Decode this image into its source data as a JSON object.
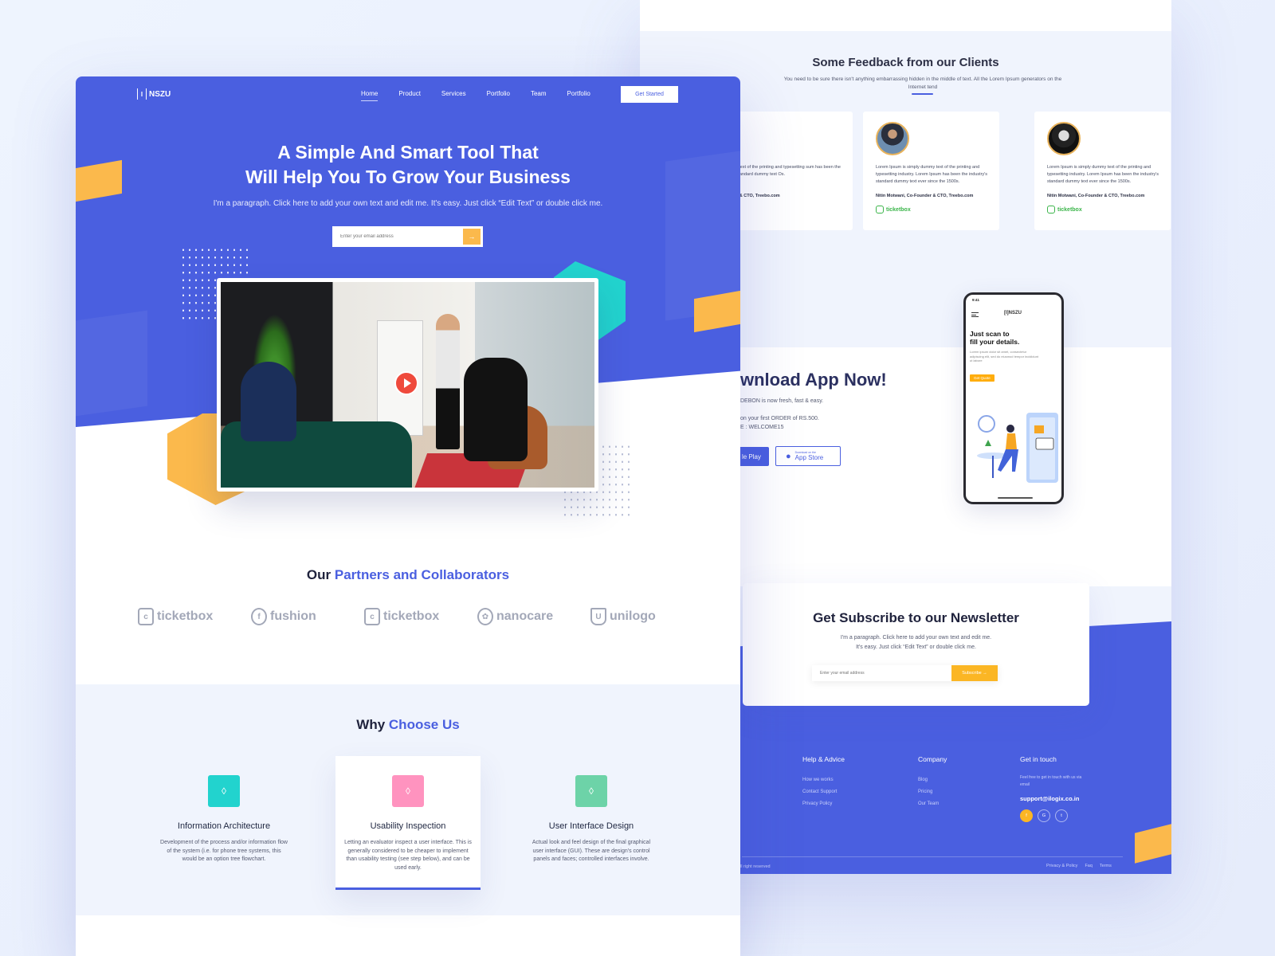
{
  "colors": {
    "primary": "#4a5fe0",
    "accent_yellow": "#fbb94c",
    "teal": "#22d3ce",
    "pink": "#ff93bf",
    "green": "#6dd3a8",
    "ticketbox_green": "#3bb54a"
  },
  "header": {
    "logo": "NSZU",
    "logo_mark": "I",
    "nav": [
      "Home",
      "Product",
      "Services",
      "Portfolio",
      "Team",
      "Portfolio"
    ],
    "active_nav": "Home",
    "cta": "Get Started"
  },
  "hero": {
    "title_line1": "A Simple And Smart Tool That",
    "title_line2": "Will Help You To Grow  Your Business",
    "subtitle": "I'm a paragraph. Click here to add your own text and edit me. It's easy. Just click “Edit Text” or double click me.",
    "email_placeholder": "Enter your email address",
    "submit_icon": "arrow-right-icon",
    "video_play_icon": "play-icon"
  },
  "partners": {
    "title_plain": "Our",
    "title_highlight": "Partners and Collaborators",
    "logos": [
      {
        "name": "ticketbox",
        "icon": "ticketbox-logo-icon"
      },
      {
        "name": "fushion",
        "icon": "fushion-logo-icon"
      },
      {
        "name": "ticketbox",
        "icon": "ticketbox-logo-icon"
      },
      {
        "name": "nanocare",
        "icon": "nanocare-logo-icon"
      },
      {
        "name": "unilogo",
        "icon": "unilogo-logo-icon"
      }
    ]
  },
  "why": {
    "title_plain": "Why",
    "title_highlight": "Choose Us",
    "cards": [
      {
        "title": "Information Architecture",
        "text": "Development of the process and/or information flow of the system (i.e. for phone tree systems, this would be an option tree flowchart.",
        "icon": "vector-nodes-icon",
        "color": "#22d3ce"
      },
      {
        "title": "Usability Inspection",
        "text": "Letting an evaluator inspect a user interface. This is generally considered to be cheaper to implement than usability testing (see step below), and can be used early.",
        "icon": "vector-nodes-icon",
        "color": "#ff93bf"
      },
      {
        "title": "User Interface Design",
        "text": "Actual look and feel design of the final graphical user interface (GUI). These are design's control panels and faces; controlled interfaces involve.",
        "icon": "vector-nodes-icon",
        "color": "#6dd3a8"
      }
    ]
  },
  "feedback": {
    "title": "Some Feedback from our Clients",
    "subtitle": "You need to be sure there isn't anything embarrassing hidden in the middle of text. All the Lorem Ipsum generators on the Internet tend",
    "cards": [
      {
        "quote": "ply dummy text of the printing and typesetting sum has been the industry's standard dummy text Os.",
        "author": "o-Founder & CTO, Treebo.com",
        "brand": ""
      },
      {
        "quote": "Lorem Ipsum is simply dummy text of the printing and typesetting industry. Lorem Ipsum has been the industry's standard dummy text ever since the 1500s.",
        "author": "Nitin Motwani, Co-Founder & CTO, Treebo.com",
        "brand": "ticketbox"
      },
      {
        "quote": "Lorem Ipsum is simply dummy text of the printing and typesetting industry. Lorem Ipsum has been the industry's standard dummy text ever since the 1500s.",
        "author": "Nitin Motwani, Co-Founder & CTO, Treebo.com",
        "brand": "ticketbox"
      }
    ]
  },
  "app": {
    "title": "wnload App Now!",
    "line1": "DEBON is now fresh, fast & easy.",
    "line2": "on your first  ORDER of RS.500.",
    "line3": "E : WELCOME15",
    "google_play": "le Play",
    "app_store_small": "Download on the",
    "app_store": "App Store",
    "phone": {
      "time": "9:41",
      "logo": "[I]NSZU",
      "heading_line1": "Just scan to",
      "heading_line2": "fill your details.",
      "text": "Lorem ipsum dolor sit amet, consectetur adipiscing elit, sed do eiusmod tempor incididunt ut labore",
      "cta": "Get Quote"
    }
  },
  "newsletter": {
    "title": "Get Subscribe to our Newsletter",
    "line1": "I'm a paragraph. Click here to add your own text and edit me.",
    "line2": "It's easy. Just click “Edit Text” or double click me.",
    "email_placeholder": "Enter your email address",
    "button": "Subscribe →"
  },
  "footer": {
    "help_title": "Help & Advice",
    "help_links": [
      "How we works",
      "Contact Support",
      "Privacy Policy"
    ],
    "company_title": "Company",
    "company_links": [
      "Blog",
      "Pricing",
      "Our Team"
    ],
    "touch_title": "Get in touch",
    "touch_text": "Feel free to get in touch with us via email",
    "email": "support@ilogix.co.in",
    "socials": [
      {
        "icon": "facebook-icon",
        "glyph": "f"
      },
      {
        "icon": "google-icon",
        "glyph": "G"
      },
      {
        "icon": "twitter-icon",
        "glyph": "t"
      }
    ],
    "copyright": "ll right reserved",
    "bottom_links": [
      "Privacy & Policy",
      "Faq",
      "Terms"
    ]
  }
}
